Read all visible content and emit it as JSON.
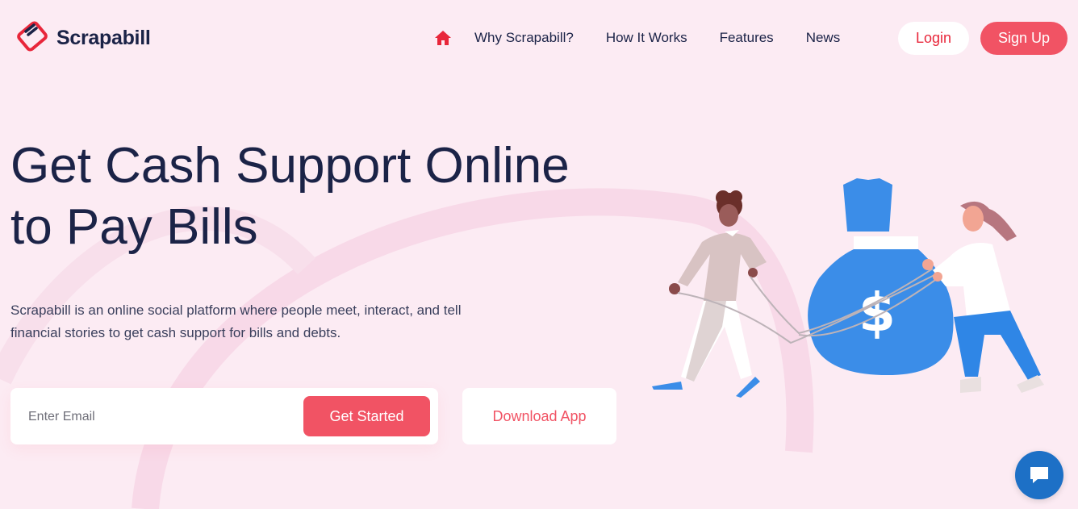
{
  "brand": {
    "name": "Scrapabill",
    "logo_icon": "card-logo-icon",
    "accent": "#e8263a"
  },
  "nav": {
    "home_icon": "home-icon",
    "links": [
      {
        "label": "Why Scrapabill?"
      },
      {
        "label": "How It Works"
      },
      {
        "label": "Features"
      },
      {
        "label": "News"
      }
    ],
    "login_label": "Login",
    "signup_label": "Sign Up"
  },
  "hero": {
    "title_line1": "Get Cash Support Online",
    "title_line2": "to Pay Bills",
    "subtitle_line1": "Scrapabill is an online social platform where people meet, interact, and tell",
    "subtitle_line2": "financial stories to get cash support for bills and debts.",
    "email_placeholder": "Enter Email",
    "cta_label": "Get Started",
    "download_label": "Download App"
  },
  "illustration": {
    "bag_symbol": "$"
  },
  "colors": {
    "background": "#fcebf3",
    "primary": "#f15364",
    "text": "#1b2347",
    "bag": "#3b8de8",
    "chat": "#1d70c6"
  },
  "chat": {
    "icon": "chat-bubble-icon"
  }
}
